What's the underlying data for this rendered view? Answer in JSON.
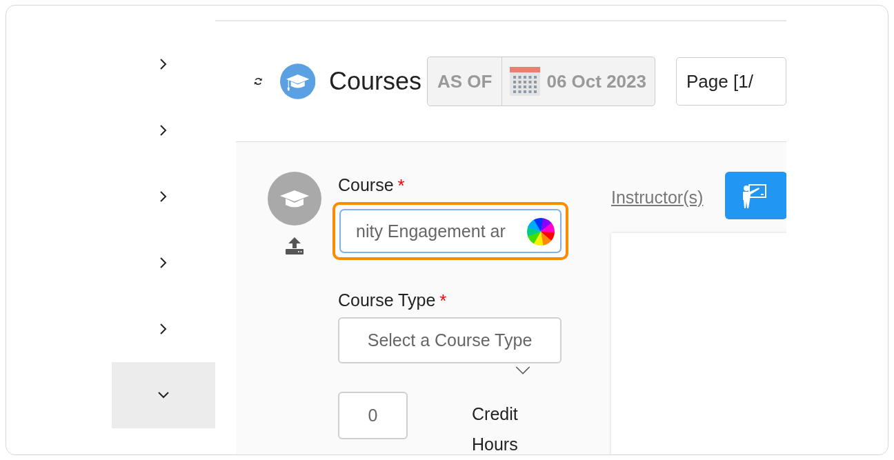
{
  "sidebar": {
    "items": [
      {
        "expanded": false
      },
      {
        "expanded": false
      },
      {
        "expanded": false
      },
      {
        "expanded": false
      },
      {
        "expanded": false
      },
      {
        "expanded": true
      }
    ]
  },
  "header": {
    "title": "Courses",
    "as_of_label": "AS OF",
    "date": "06 Oct 2023",
    "page": "Page [1/"
  },
  "form": {
    "course": {
      "label": "Course",
      "required_mark": "*",
      "value": "nity Engagement ar",
      "focused": true
    },
    "course_type": {
      "label": "Course Type",
      "required_mark": "*",
      "placeholder": "Select a Course Type",
      "focused": false
    },
    "credit_hours": {
      "value": "0",
      "label": "Credit Hours"
    }
  },
  "instructors": {
    "link": "Instructor(s)"
  }
}
